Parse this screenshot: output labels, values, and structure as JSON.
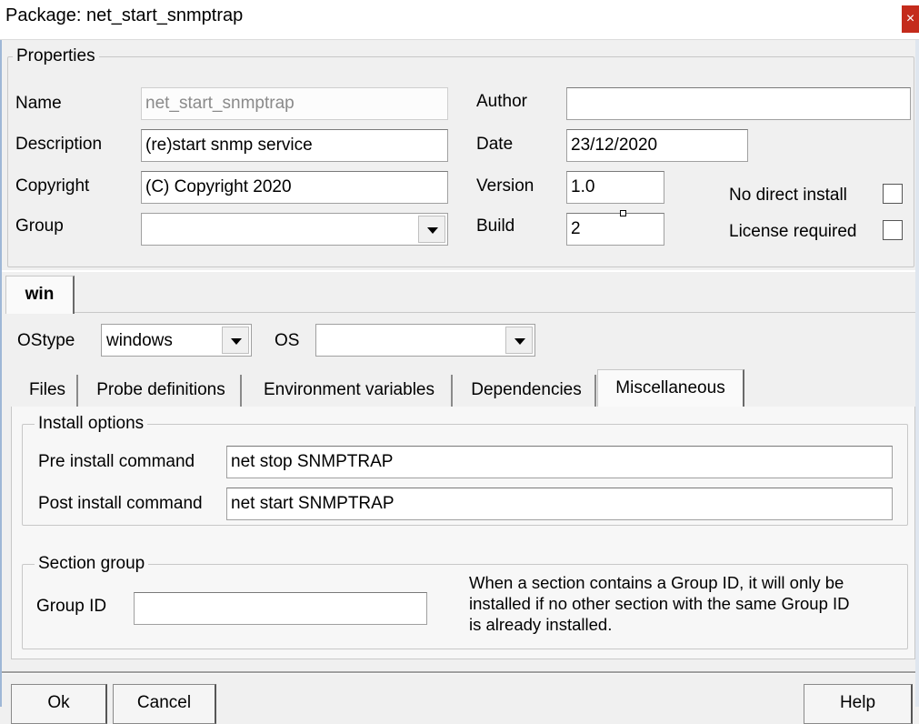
{
  "window": {
    "title": "Package: net_start_snmptrap",
    "close_glyph": "×"
  },
  "properties": {
    "group_label": "Properties",
    "name": {
      "label": "Name",
      "value": "net_start_snmptrap"
    },
    "description": {
      "label": "Description",
      "value": "(re)start snmp service"
    },
    "copyright": {
      "label": "Copyright",
      "value": "(C) Copyright 2020"
    },
    "group": {
      "label": "Group",
      "value": ""
    },
    "author": {
      "label": "Author",
      "value": ""
    },
    "date": {
      "label": "Date",
      "value": "23/12/2020"
    },
    "version": {
      "label": "Version",
      "value": "1.0"
    },
    "build": {
      "label": "Build",
      "value": "2"
    },
    "no_direct_install": {
      "label": "No direct install",
      "checked": false
    },
    "license_required": {
      "label": "License required",
      "checked": false
    }
  },
  "platform_tab": {
    "label": "win"
  },
  "ostype": {
    "label": "OStype",
    "value": "windows"
  },
  "os": {
    "label": "OS",
    "value": ""
  },
  "tabs": [
    {
      "label": "Files",
      "active": false
    },
    {
      "label": "Probe definitions",
      "active": false
    },
    {
      "label": "Environment variables",
      "active": false
    },
    {
      "label": "Dependencies",
      "active": false
    },
    {
      "label": "Miscellaneous",
      "active": true
    }
  ],
  "install_options": {
    "group_label": "Install options",
    "pre": {
      "label": "Pre install command",
      "value": "net stop SNMPTRAP"
    },
    "post": {
      "label": "Post install command",
      "value": "net start SNMPTRAP"
    }
  },
  "section_group": {
    "group_label": "Section group",
    "group_id": {
      "label": "Group ID",
      "value": ""
    },
    "note_lines": [
      "When a section contains a Group ID, it will only be",
      "installed if no other section with the same Group ID",
      "is already installed."
    ]
  },
  "buttons": {
    "ok": "Ok",
    "cancel": "Cancel",
    "help": "Help"
  }
}
